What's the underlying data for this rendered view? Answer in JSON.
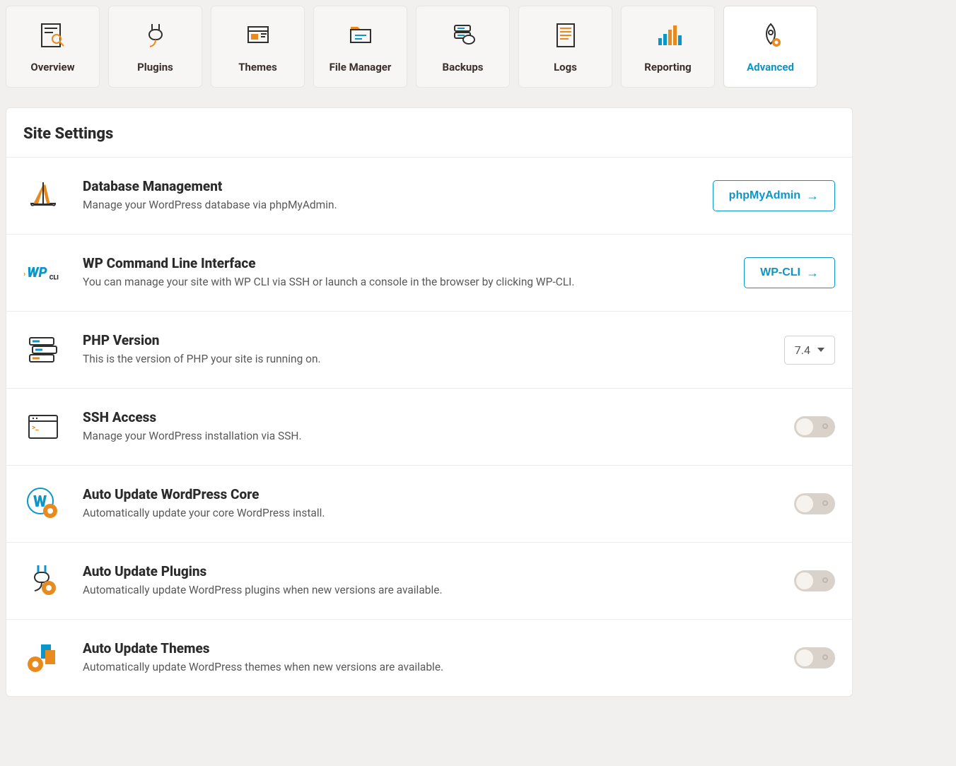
{
  "tabs": [
    {
      "label": "Overview"
    },
    {
      "label": "Plugins"
    },
    {
      "label": "Themes"
    },
    {
      "label": "File Manager"
    },
    {
      "label": "Backups"
    },
    {
      "label": "Logs"
    },
    {
      "label": "Reporting"
    },
    {
      "label": "Advanced"
    }
  ],
  "panel": {
    "title": "Site Settings",
    "rows": {
      "database": {
        "title": "Database Management",
        "desc": "Manage your WordPress database via phpMyAdmin.",
        "button": "phpMyAdmin"
      },
      "wpcli": {
        "title": "WP Command Line Interface",
        "desc": "You can manage your site with WP CLI via SSH or launch a console in the browser by clicking WP-CLI.",
        "button": "WP-CLI"
      },
      "php": {
        "title": "PHP Version",
        "desc": "This is the version of PHP your site is running on.",
        "value": "7.4"
      },
      "ssh": {
        "title": "SSH Access",
        "desc": "Manage your WordPress installation via SSH.",
        "on": false
      },
      "core": {
        "title": "Auto Update WordPress Core",
        "desc": "Automatically update your core WordPress install.",
        "on": false
      },
      "plugins": {
        "title": "Auto Update Plugins",
        "desc": "Automatically update WordPress plugins when new versions are available.",
        "on": false
      },
      "themes": {
        "title": "Auto Update Themes",
        "desc": "Automatically update WordPress themes when new versions are available.",
        "on": false
      }
    }
  }
}
